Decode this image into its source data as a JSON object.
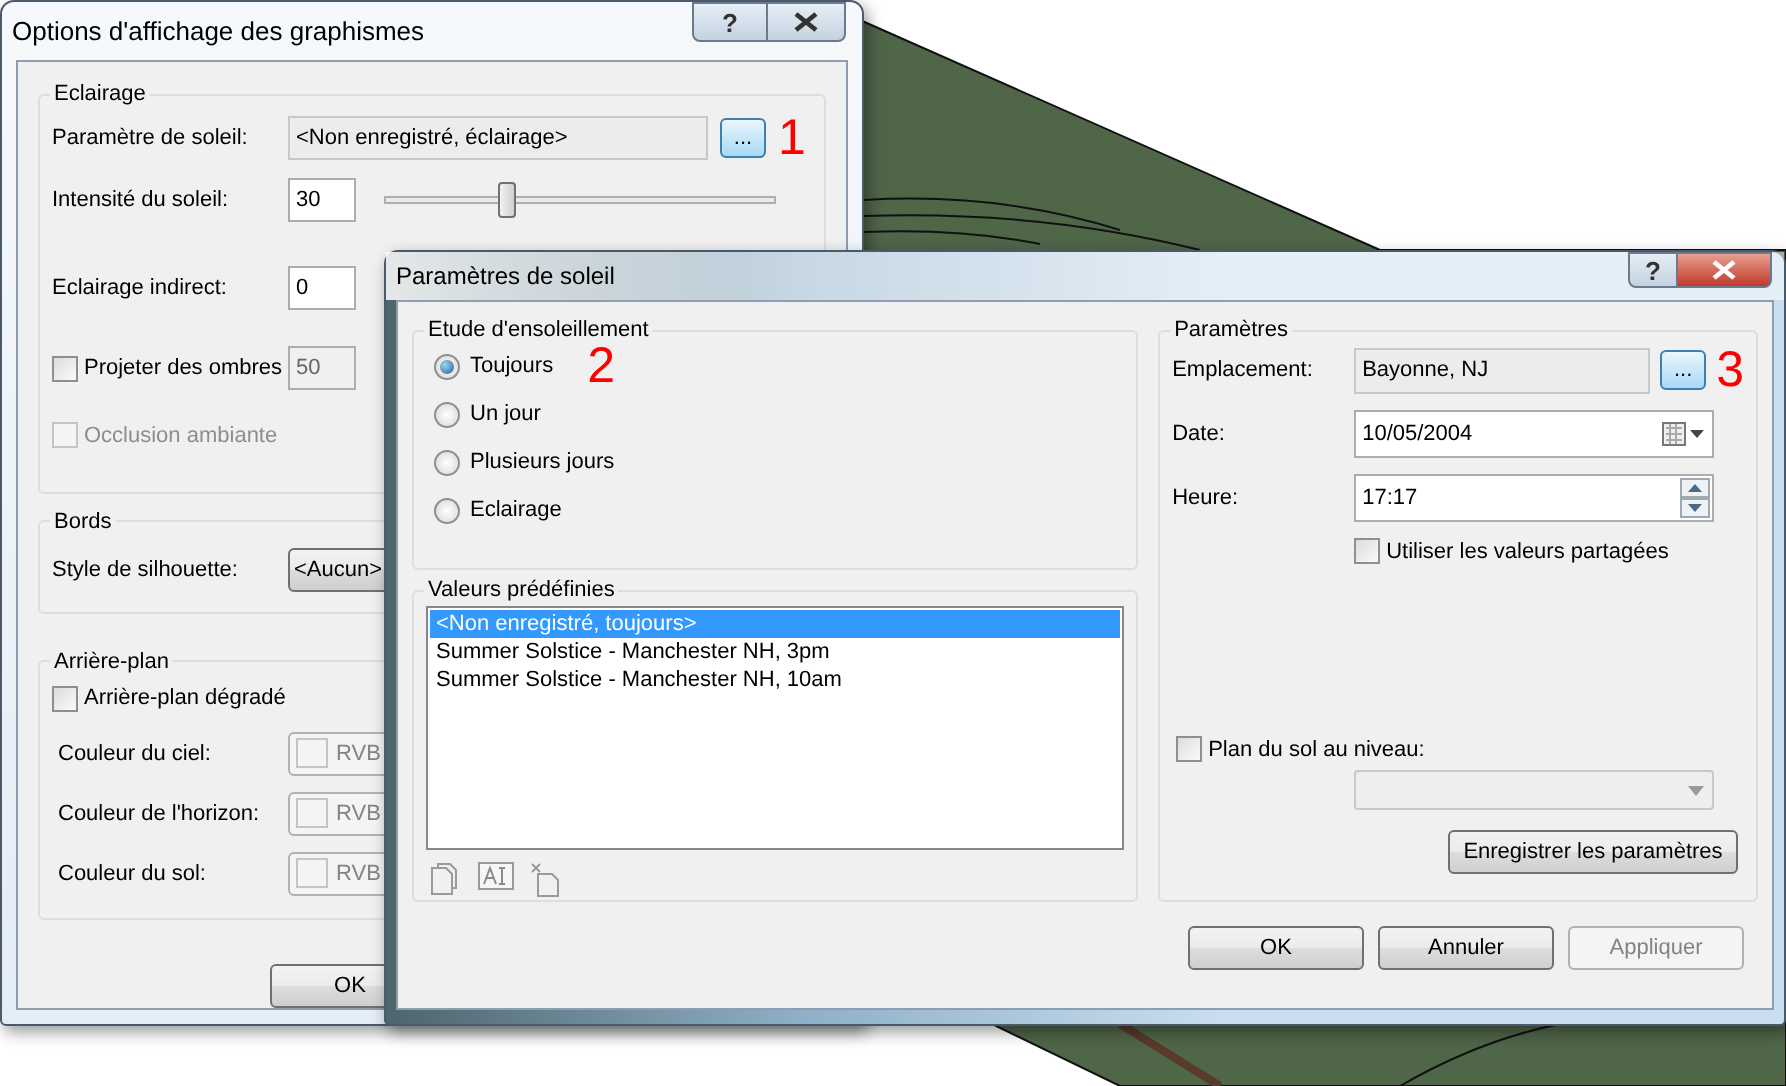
{
  "graphics_dialog": {
    "title": "Options d'affichage des graphismes",
    "help_button": "?",
    "lighting": {
      "group_title": "Eclairage",
      "sun_setting": {
        "label": "Paramètre de soleil:",
        "value": "<Non enregistré, éclairage>",
        "browse_button": "...",
        "callout": "1"
      },
      "sun_intensity": {
        "label": "Intensité du soleil:",
        "value": "30",
        "level": 0.31
      },
      "indirect_lighting": {
        "label": "Eclairage indirect:",
        "value": "0"
      },
      "cast_shadows": {
        "label": "Projeter des ombres",
        "checked": false,
        "value": "50",
        "disabled": true
      },
      "ambient_occlusion": {
        "label": "Occlusion ambiante",
        "checked": false,
        "disabled": true
      }
    },
    "edges": {
      "group_title": "Bords",
      "silhouette_style": {
        "label": "Style de silhouette:",
        "value": "<Aucun>"
      }
    },
    "background": {
      "group_title": "Arrière-plan",
      "gradient": {
        "label": "Arrière-plan dégradé",
        "checked": false
      },
      "colors": [
        {
          "label": "Couleur du ciel:",
          "button": "RVB",
          "disabled": true
        },
        {
          "label": "Couleur de l'horizon:",
          "button": "RVB",
          "disabled": true
        },
        {
          "label": "Couleur du sol:",
          "button": "RVB",
          "disabled": true
        }
      ]
    },
    "buttons": [
      "OK"
    ]
  },
  "sun_dialog": {
    "title": "Paramètres de soleil",
    "help_button": "?",
    "study": {
      "group_title": "Etude d'ensoleillement",
      "callout": "2",
      "options": [
        {
          "label": "Toujours",
          "selected": true
        },
        {
          "label": "Un jour",
          "selected": false
        },
        {
          "label": "Plusieurs jours",
          "selected": false
        },
        {
          "label": "Eclairage",
          "selected": false
        }
      ]
    },
    "presets": {
      "group_title": "Valeurs prédéfinies",
      "items": [
        {
          "label": "<Non enregistré, toujours>",
          "selected": true
        },
        {
          "label": "Summer Solstice - Manchester NH, 3pm",
          "selected": false
        },
        {
          "label": "Summer Solstice - Manchester NH, 10am",
          "selected": false
        }
      ]
    },
    "parameters": {
      "group_title": "Paramètres",
      "location": {
        "label": "Emplacement:",
        "value": "Bayonne, NJ",
        "browse_button": "...",
        "callout": "3"
      },
      "date": {
        "label": "Date:",
        "value": "10/05/2004"
      },
      "time": {
        "label": "Heure:",
        "value": "17:17"
      },
      "shared_values": {
        "label": "Utiliser les valeurs partagées",
        "checked": false
      },
      "ground_plane": {
        "label": "Plan du sol au niveau:",
        "checked": false
      },
      "save_button": "Enregistrer les paramètres"
    },
    "buttons": [
      {
        "label": "OK",
        "disabled": false
      },
      {
        "label": "Annuler",
        "disabled": false
      },
      {
        "label": "Appliquer",
        "disabled": true
      }
    ]
  }
}
